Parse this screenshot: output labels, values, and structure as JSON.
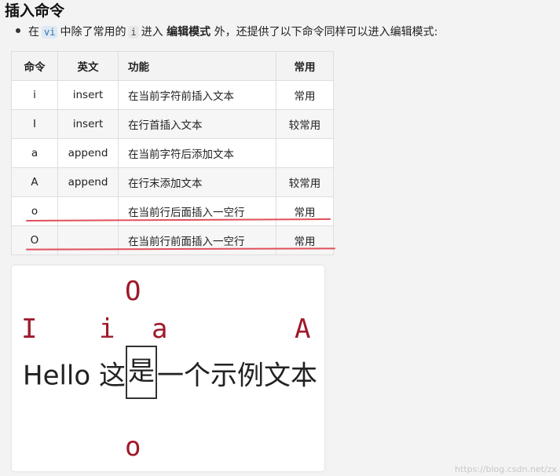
{
  "title": "插入命令",
  "intro": {
    "t1": "在",
    "code_vi": "vi",
    "t2": "中除了常用的",
    "code_i": "i",
    "t3": "进入",
    "bold": "编辑模式",
    "t4": "外，还提供了以下命令同样可以进入编辑模式:"
  },
  "table": {
    "headers": [
      "命令",
      "英文",
      "功能",
      "常用"
    ],
    "rows": [
      {
        "cmd": "i",
        "en": "insert",
        "func": "在当前字符前插入文本",
        "common": "常用"
      },
      {
        "cmd": "I",
        "en": "insert",
        "func": "在行首插入文本",
        "common": "较常用"
      },
      {
        "cmd": "a",
        "en": "append",
        "func": "在当前字符后添加文本",
        "common": ""
      },
      {
        "cmd": "A",
        "en": "append",
        "func": "在行末添加文本",
        "common": "较常用"
      },
      {
        "cmd": "o",
        "en": "",
        "func": "在当前行后面插入一空行",
        "common": "常用"
      },
      {
        "cmd": "O",
        "en": "",
        "func": "在当前行前面插入一空行",
        "common": "常用"
      }
    ]
  },
  "illustration": {
    "top_label": "O",
    "left_label": "I",
    "i_label": "i",
    "a_label": "a",
    "right_label": "A",
    "bottom_label": "o",
    "sample_before": "Hello 这",
    "sample_cursor": "是",
    "sample_after": "一个示例文本"
  },
  "watermark": "https://blog.csdn.net/zx",
  "colors": {
    "accent_red": "#9e1a2a",
    "underline_red": "#e0505a"
  }
}
